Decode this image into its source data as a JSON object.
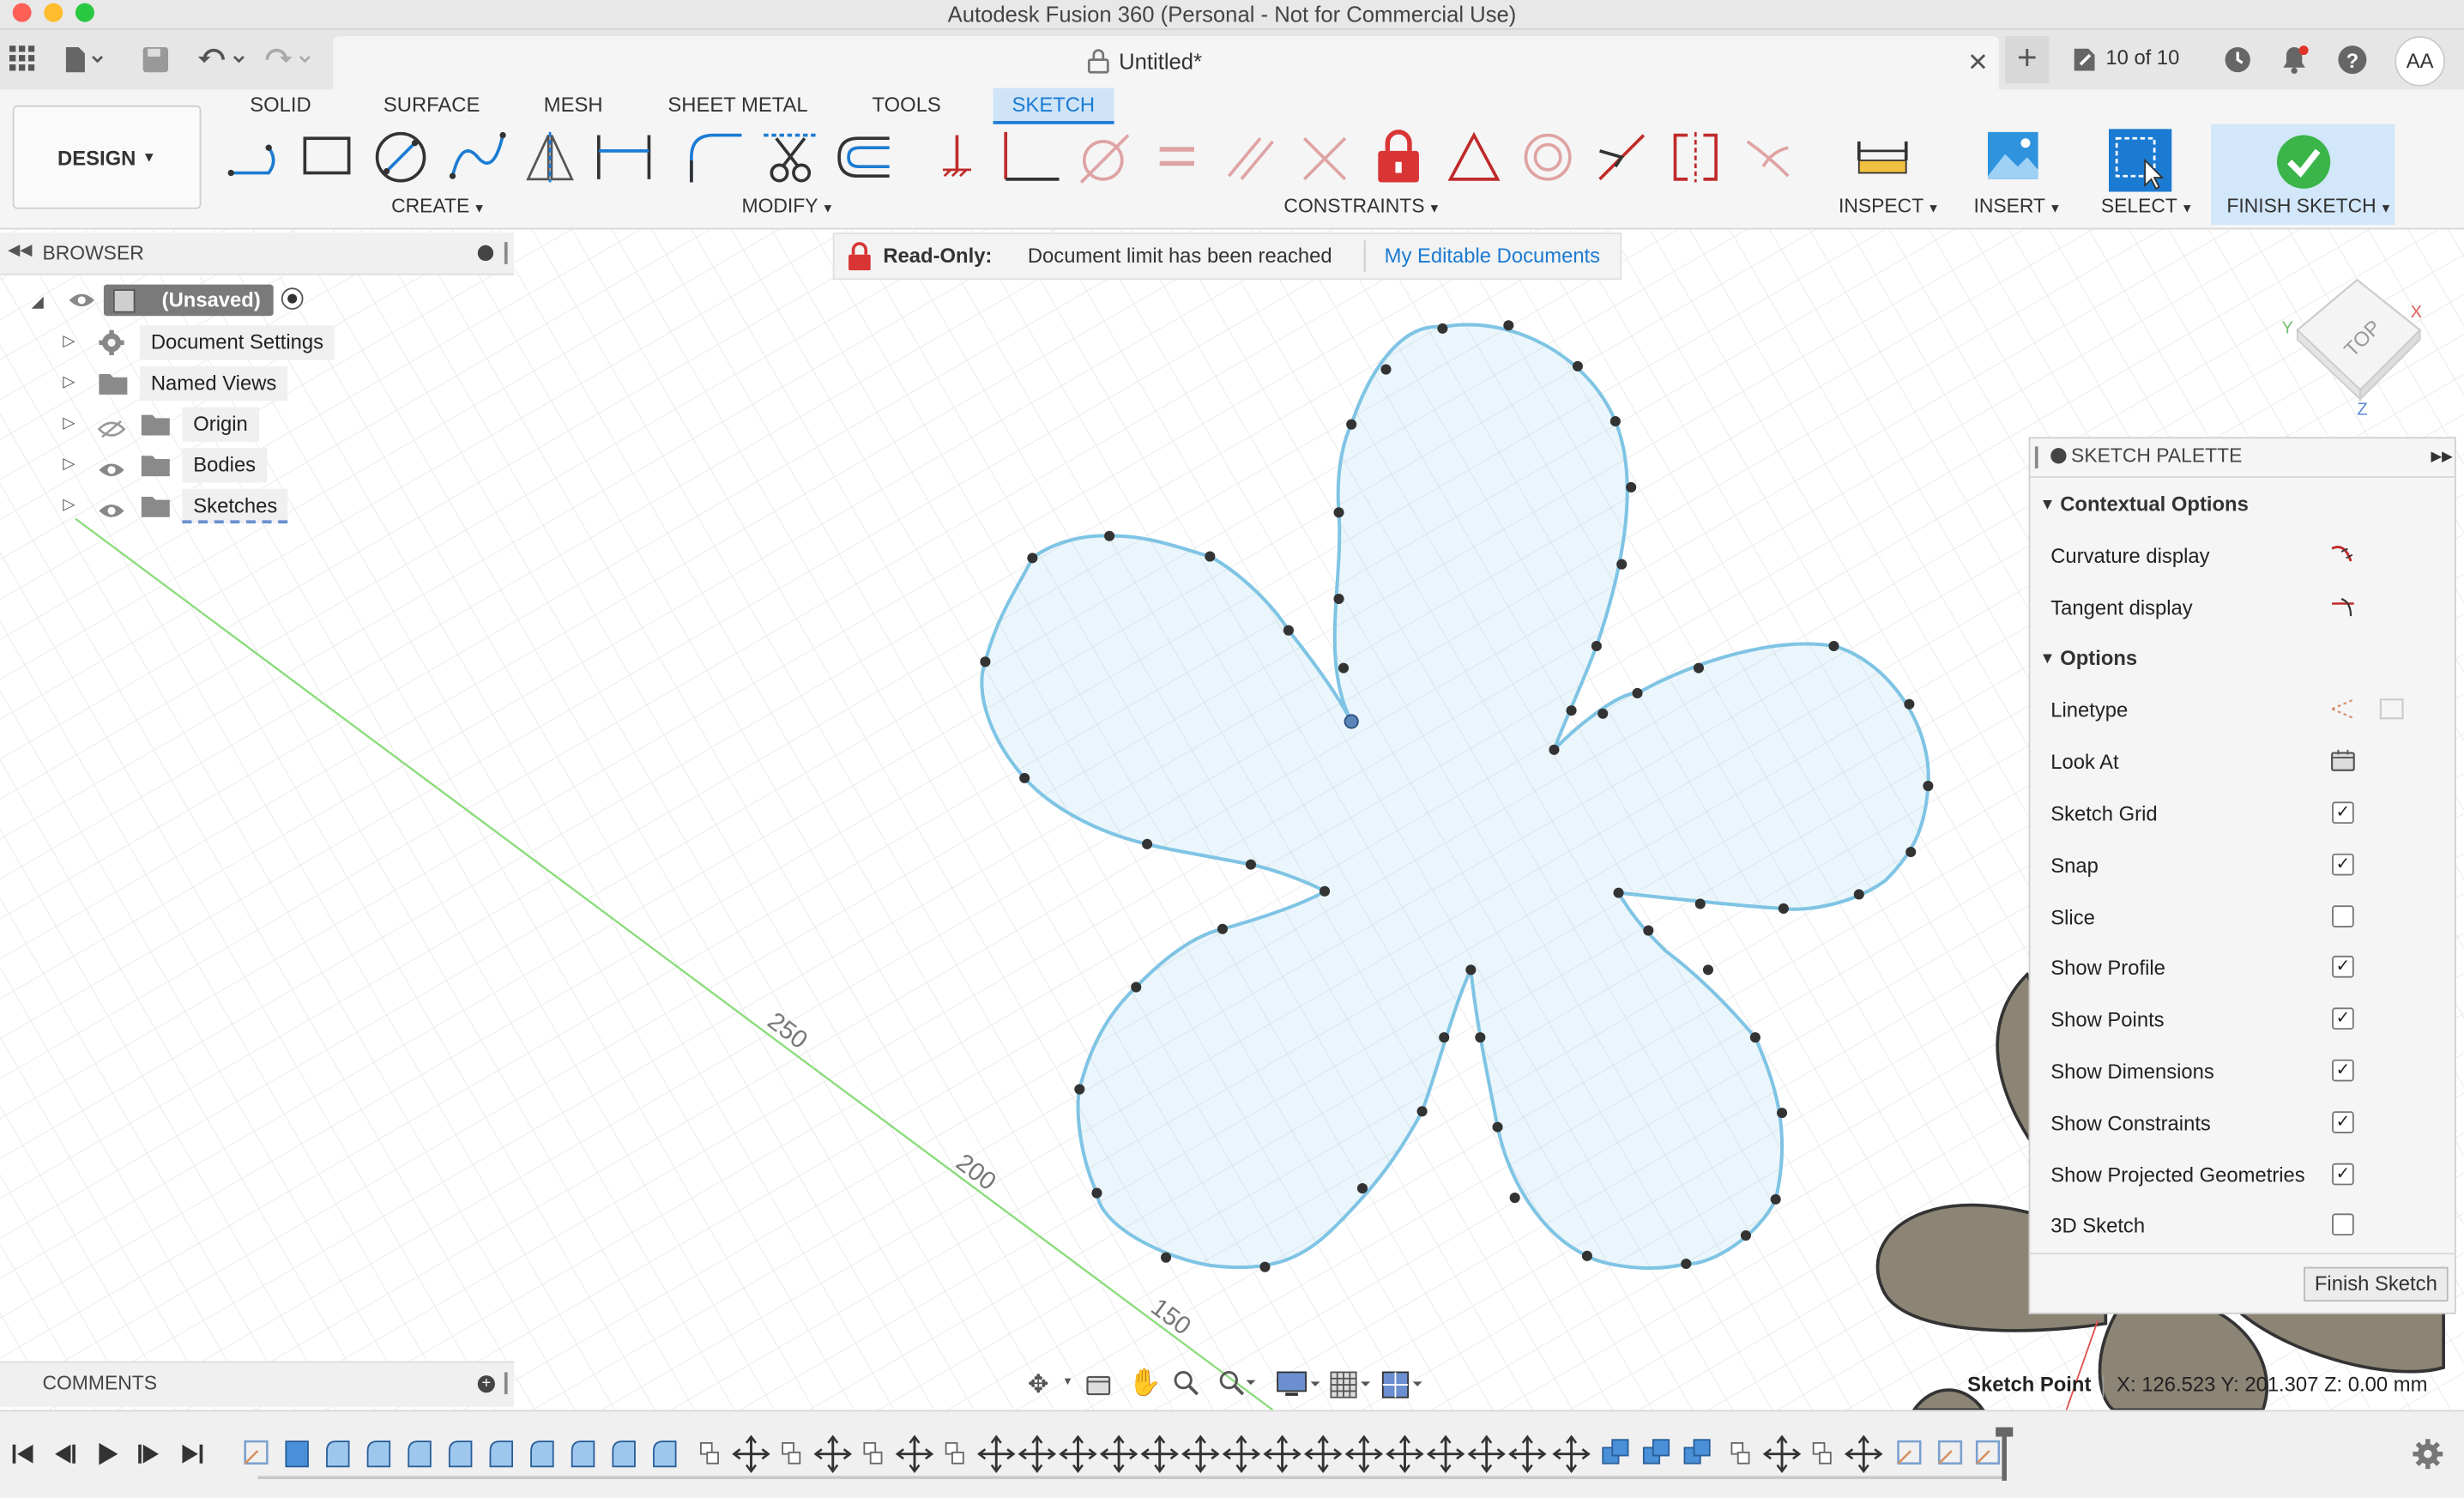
{
  "window": {
    "title": "Autodesk Fusion 360 (Personal - Not for Commercial Use)"
  },
  "tabbar": {
    "doc_title": "Untitled*",
    "doc_count": "10 of 10",
    "user_initials": "AA"
  },
  "ribbon": {
    "design_label": "DESIGN",
    "tabs": [
      "SOLID",
      "SURFACE",
      "MESH",
      "SHEET METAL",
      "TOOLS",
      "SKETCH"
    ],
    "active_tab": "SKETCH",
    "groups": {
      "create": "CREATE",
      "modify": "MODIFY",
      "constraints": "CONSTRAINTS",
      "inspect": "INSPECT",
      "insert": "INSERT",
      "select": "SELECT",
      "finish": "FINISH SKETCH"
    },
    "accent_color": "#1b7bd3"
  },
  "browser": {
    "header": "BROWSER",
    "root_label": "(Unsaved)",
    "items": [
      {
        "label": "Document Settings",
        "icon": "gear-icon"
      },
      {
        "label": "Named Views",
        "icon": "folder-icon"
      },
      {
        "label": "Origin",
        "icon": "folder-icon"
      },
      {
        "label": "Bodies",
        "icon": "folder-icon"
      },
      {
        "label": "Sketches",
        "icon": "folder-icon"
      }
    ]
  },
  "banner": {
    "label": "Read-Only:",
    "message": "Document limit has been reached",
    "link": "My Editable Documents"
  },
  "canvas": {
    "axis_labels": [
      "250",
      "200",
      "150"
    ],
    "viewcube_label": "TOP",
    "profile_color": "#7fc4e4"
  },
  "palette": {
    "header": "SKETCH PALETTE",
    "section_contextual": "Contextual Options",
    "section_options": "Options",
    "contextual": [
      {
        "label": "Curvature display"
      },
      {
        "label": "Tangent display"
      }
    ],
    "options": [
      {
        "label": "Linetype",
        "kind": "icons"
      },
      {
        "label": "Look At",
        "kind": "icon"
      },
      {
        "label": "Sketch Grid",
        "checked": true
      },
      {
        "label": "Snap",
        "checked": true
      },
      {
        "label": "Slice",
        "checked": false
      },
      {
        "label": "Show Profile",
        "checked": true
      },
      {
        "label": "Show Points",
        "checked": true
      },
      {
        "label": "Show Dimensions",
        "checked": true
      },
      {
        "label": "Show Constraints",
        "checked": true
      },
      {
        "label": "Show Projected Geometries",
        "checked": true
      },
      {
        "label": "3D Sketch",
        "checked": false
      }
    ],
    "finish_button": "Finish Sketch"
  },
  "comments": {
    "header": "COMMENTS"
  },
  "status": {
    "label": "Sketch Point",
    "coords": "X: 126.523 Y: 201.307 Z: 0.00 mm"
  }
}
